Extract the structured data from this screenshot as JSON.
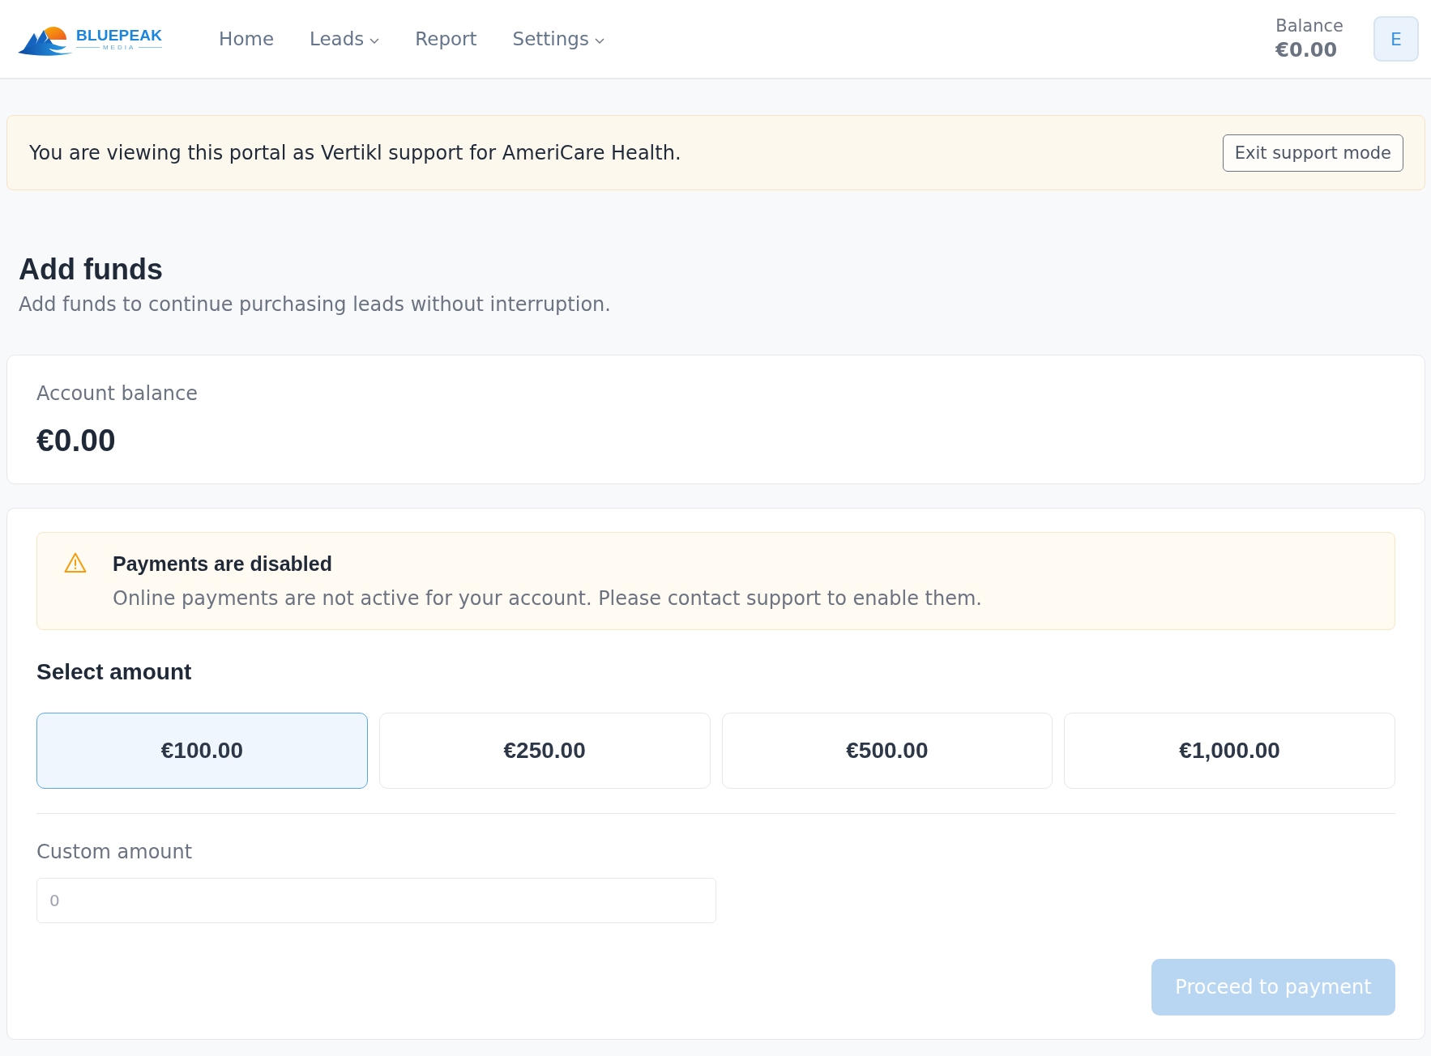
{
  "header": {
    "logo": {
      "name": "BLUEPEAK",
      "tagline": "MEDIA"
    },
    "nav": [
      {
        "label": "Home",
        "has_dropdown": false
      },
      {
        "label": "Leads",
        "has_dropdown": true
      },
      {
        "label": "Report",
        "has_dropdown": false
      },
      {
        "label": "Settings",
        "has_dropdown": true
      }
    ],
    "balance": {
      "label": "Balance",
      "value": "€0.00"
    },
    "avatar": {
      "initial": "E"
    }
  },
  "support_banner": {
    "message": "You are viewing this portal as Vertikl support for AmeriCare Health.",
    "button": "Exit support mode"
  },
  "page": {
    "title": "Add funds",
    "subtitle": "Add funds to continue purchasing leads without interruption."
  },
  "account_balance": {
    "label": "Account balance",
    "value": "€0.00"
  },
  "payment_card": {
    "alert": {
      "kind": "warning",
      "title": "Payments are disabled",
      "message": "Online payments are not active for your account. Please contact support to enable them."
    },
    "select_amount": {
      "heading": "Select amount",
      "options": [
        {
          "label": "€100.00",
          "selected": true
        },
        {
          "label": "€250.00",
          "selected": false
        },
        {
          "label": "€500.00",
          "selected": false
        },
        {
          "label": "€1,000.00",
          "selected": false
        }
      ]
    },
    "custom_amount": {
      "label": "Custom amount",
      "placeholder": "0"
    },
    "proceed_button": {
      "label": "Proceed to payment",
      "disabled": true
    }
  }
}
